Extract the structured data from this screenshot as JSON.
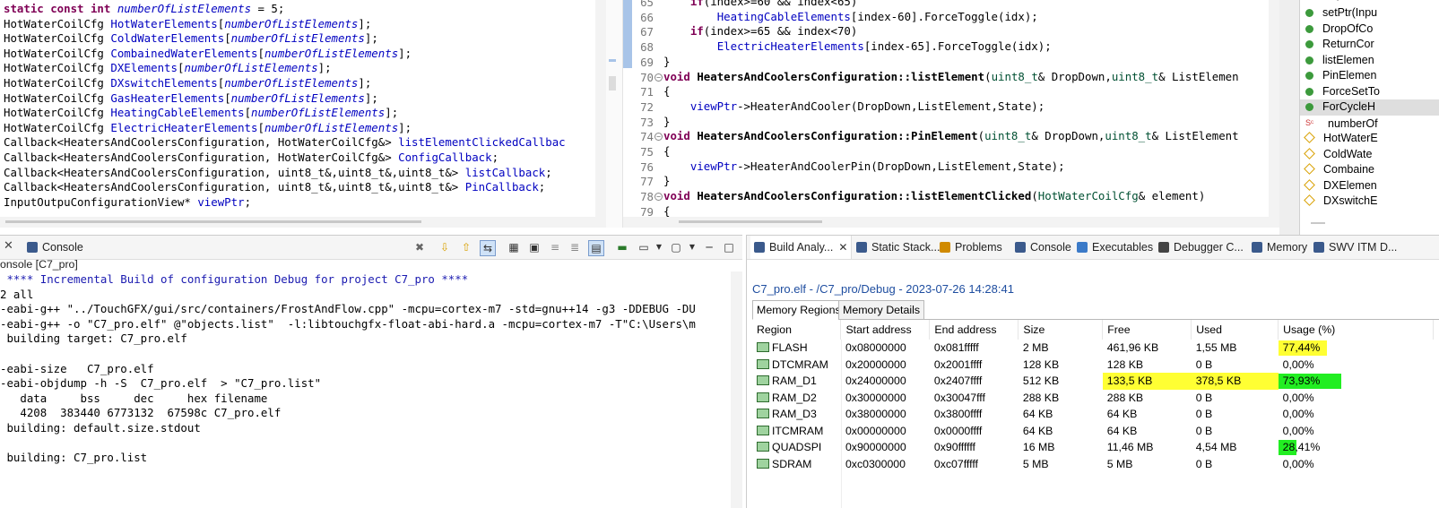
{
  "header_code": {
    "lines": [
      [
        [
          "kw",
          "static const int "
        ],
        [
          "it",
          "numberOfListElements"
        ],
        [
          "id",
          " = 5;"
        ]
      ],
      [
        [
          "id",
          "HotWaterCoilCfg "
        ],
        [
          "var",
          "HotWaterElements"
        ],
        [
          "id",
          "["
        ],
        [
          "it",
          "numberOfListElements"
        ],
        [
          "id",
          "];"
        ]
      ],
      [
        [
          "id",
          "HotWaterCoilCfg "
        ],
        [
          "var",
          "ColdWaterElements"
        ],
        [
          "id",
          "["
        ],
        [
          "it",
          "numberOfListElements"
        ],
        [
          "id",
          "];"
        ]
      ],
      [
        [
          "id",
          "HotWaterCoilCfg "
        ],
        [
          "var",
          "CombainedWaterElements"
        ],
        [
          "id",
          "["
        ],
        [
          "it",
          "numberOfListElements"
        ],
        [
          "id",
          "];"
        ]
      ],
      [
        [
          "id",
          "HotWaterCoilCfg "
        ],
        [
          "var",
          "DXElements"
        ],
        [
          "id",
          "["
        ],
        [
          "it",
          "numberOfListElements"
        ],
        [
          "id",
          "];"
        ]
      ],
      [
        [
          "id",
          "HotWaterCoilCfg "
        ],
        [
          "var",
          "DXswitchElements"
        ],
        [
          "id",
          "["
        ],
        [
          "it",
          "numberOfListElements"
        ],
        [
          "id",
          "];"
        ]
      ],
      [
        [
          "id",
          "HotWaterCoilCfg "
        ],
        [
          "var",
          "GasHeaterElements"
        ],
        [
          "id",
          "["
        ],
        [
          "it",
          "numberOfListElements"
        ],
        [
          "id",
          "];"
        ]
      ],
      [
        [
          "id",
          "HotWaterCoilCfg "
        ],
        [
          "var",
          "HeatingCableElements"
        ],
        [
          "id",
          "["
        ],
        [
          "it",
          "numberOfListElements"
        ],
        [
          "id",
          "];"
        ]
      ],
      [
        [
          "id",
          "HotWaterCoilCfg "
        ],
        [
          "var",
          "ElectricHeaterElements"
        ],
        [
          "id",
          "["
        ],
        [
          "it",
          "numberOfListElements"
        ],
        [
          "id",
          "];"
        ]
      ],
      [
        [
          "id",
          "Callback<HeatersAndCoolersConfiguration, HotWaterCoilCfg&> "
        ],
        [
          "var",
          "listElementClickedCallbac"
        ]
      ],
      [
        [
          "id",
          "Callback<HeatersAndCoolersConfiguration, HotWaterCoilCfg&> "
        ],
        [
          "var",
          "ConfigCallback"
        ],
        [
          "id",
          ";"
        ]
      ],
      [
        [
          "id",
          "Callback<HeatersAndCoolersConfiguration, uint8_t&,uint8_t&,uint8_t&> "
        ],
        [
          "var",
          "listCallback"
        ],
        [
          "id",
          ";"
        ]
      ],
      [
        [
          "id",
          "Callback<HeatersAndCoolersConfiguration, uint8_t&,uint8_t&,uint8_t&> "
        ],
        [
          "var",
          "PinCallback"
        ],
        [
          "id",
          ";"
        ]
      ],
      [
        [
          "id",
          "InputOutpuConfigurationView* "
        ],
        [
          "var",
          "viewPtr"
        ],
        [
          "id",
          ";"
        ]
      ]
    ]
  },
  "source_code": {
    "line_numbers": [
      "65",
      "66",
      "67",
      "68",
      "69",
      "70",
      "71",
      "72",
      "73",
      "74",
      "75",
      "76",
      "77",
      "78",
      "79"
    ],
    "fold_markers": [
      "70",
      "74",
      "78"
    ],
    "lines": [
      [
        [
          "id",
          "    "
        ],
        [
          "kw",
          "if"
        ],
        [
          "id",
          "(index>=60 && index<65)"
        ]
      ],
      [
        [
          "id",
          "        "
        ],
        [
          "var",
          "HeatingCableElements"
        ],
        [
          "id",
          "[index-60].ForceToggle(idx);"
        ]
      ],
      [
        [
          "id",
          "    "
        ],
        [
          "kw",
          "if"
        ],
        [
          "id",
          "(index>=65 && index<70)"
        ]
      ],
      [
        [
          "id",
          "        "
        ],
        [
          "var",
          "ElectricHeaterElements"
        ],
        [
          "id",
          "[index-65].ForceToggle(idx);"
        ]
      ],
      [
        [
          "id",
          "}"
        ]
      ],
      [
        [
          "kw",
          "void "
        ],
        [
          "b",
          "HeatersAndCoolersConfiguration::listElement"
        ],
        [
          "id",
          "("
        ],
        [
          "kw2",
          "uint8_t"
        ],
        [
          "id",
          "& DropDown,"
        ],
        [
          "kw2",
          "uint8_t"
        ],
        [
          "id",
          "& ListElemen"
        ]
      ],
      [
        [
          "id",
          "{"
        ]
      ],
      [
        [
          "id",
          "    "
        ],
        [
          "var",
          "viewPtr"
        ],
        [
          "id",
          "->HeaterAndCooler(DropDown,ListElement,State);"
        ]
      ],
      [
        [
          "id",
          "}"
        ]
      ],
      [
        [
          "kw",
          "void "
        ],
        [
          "b",
          "HeatersAndCoolersConfiguration::PinElement"
        ],
        [
          "id",
          "("
        ],
        [
          "kw2",
          "uint8_t"
        ],
        [
          "id",
          "& DropDown,"
        ],
        [
          "kw2",
          "uint8_t"
        ],
        [
          "id",
          "& ListElement"
        ]
      ],
      [
        [
          "id",
          "{"
        ]
      ],
      [
        [
          "id",
          "    "
        ],
        [
          "var",
          "viewPtr"
        ],
        [
          "id",
          "->HeaterAndCoolerPin(DropDown,ListElement,State);"
        ]
      ],
      [
        [
          "id",
          "}"
        ]
      ],
      [
        [
          "kw",
          "void "
        ],
        [
          "b",
          "HeatersAndCoolersConfiguration::listElementClicked"
        ],
        [
          "id",
          "("
        ],
        [
          "kw2",
          "HotWaterCoilCfg"
        ],
        [
          "id",
          "& element)"
        ]
      ],
      [
        [
          "id",
          "{"
        ]
      ]
    ]
  },
  "outline": {
    "items": [
      {
        "label": "setPtr(Inpu",
        "icon": "method-public-icon"
      },
      {
        "label": "DropOfCo",
        "icon": "method-public-icon"
      },
      {
        "label": "ReturnCor",
        "icon": "method-public-icon"
      },
      {
        "label": "listElemen",
        "icon": "method-public-icon"
      },
      {
        "label": "PinElemen",
        "icon": "method-public-icon"
      },
      {
        "label": "ForceSetTo",
        "icon": "method-public-icon"
      },
      {
        "label": "ForCycleH",
        "icon": "method-public-icon"
      },
      {
        "label": "numberOf",
        "icon": "static-const-field-icon"
      },
      {
        "label": "HotWaterE",
        "icon": "field-icon"
      },
      {
        "label": "ColdWate",
        "icon": "field-icon"
      },
      {
        "label": "Combaine",
        "icon": "field-icon"
      },
      {
        "label": "DXElemen",
        "icon": "field-icon"
      },
      {
        "label": "DXswitchE",
        "icon": "field-icon"
      }
    ]
  },
  "console": {
    "tab_label": "Console",
    "title": "onsole [C7_pro]",
    "lines": [
      " **** Incremental Build of configuration Debug for project C7_pro ****",
      "2 all",
      "-eabi-g++ \"../TouchGFX/gui/src/containers/FrostAndFlow.cpp\" -mcpu=cortex-m7 -std=gnu++14 -g3 -DDEBUG -DU",
      "-eabi-g++ -o \"C7_pro.elf\" @\"objects.list\"  -l:libtouchgfx-float-abi-hard.a -mcpu=cortex-m7 -T\"C:\\Users\\m",
      " building target: C7_pro.elf",
      "",
      "-eabi-size   C7_pro.elf",
      "-eabi-objdump -h -S  C7_pro.elf  > \"C7_pro.list\"",
      "   data     bss     dec     hex filename",
      "   4208  383440 6773132  67598c C7_pro.elf",
      " building: default.size.stdout",
      "",
      " building: C7_pro.list"
    ]
  },
  "bottom_tabs": [
    {
      "label": "Build Analy...",
      "icon": "build-analyzer-icon",
      "active": true
    },
    {
      "label": "Static Stack...",
      "icon": "static-stack-icon"
    },
    {
      "label": "Problems",
      "icon": "problems-icon"
    },
    {
      "label": "Console",
      "icon": "console-icon"
    },
    {
      "label": "Executables",
      "icon": "executables-icon"
    },
    {
      "label": "Debugger C...",
      "icon": "debugger-icon"
    },
    {
      "label": "Memory",
      "icon": "memory-icon"
    },
    {
      "label": "SWV ITM D...",
      "icon": "swv-icon"
    }
  ],
  "build_analyzer": {
    "title": "C7_pro.elf - /C7_pro/Debug - 2023-07-26 14:28:41",
    "subtabs": [
      "Memory Regions",
      "Memory Details"
    ],
    "columns": [
      "Region",
      "Start address",
      "End address",
      "Size",
      "Free",
      "Used",
      "Usage (%)"
    ],
    "rows": [
      {
        "region": "FLASH",
        "start": "0x08000000",
        "end": "0x081fffff",
        "size": "2 MB",
        "free": "461,96 KB",
        "used": "1,55 MB",
        "usage": "77,44%",
        "usage_fill": 0.7744,
        "usage_color": "#ffff33",
        "free_hl": false,
        "used_hl": false
      },
      {
        "region": "DTCMRAM",
        "start": "0x20000000",
        "end": "0x2001ffff",
        "size": "128 KB",
        "free": "128 KB",
        "used": "0 B",
        "usage": "0,00%",
        "usage_fill": 0,
        "usage_color": "",
        "free_hl": false,
        "used_hl": false
      },
      {
        "region": "RAM_D1",
        "start": "0x24000000",
        "end": "0x2407ffff",
        "size": "512 KB",
        "free": "133,5 KB",
        "used": "378,5 KB",
        "usage": "73,93%",
        "usage_fill": 1.0,
        "usage_color": "#22ee22",
        "free_hl": true,
        "used_hl": true
      },
      {
        "region": "RAM_D2",
        "start": "0x30000000",
        "end": "0x30047fff",
        "size": "288 KB",
        "free": "288 KB",
        "used": "0 B",
        "usage": "0,00%",
        "usage_fill": 0,
        "usage_color": "",
        "free_hl": false,
        "used_hl": false
      },
      {
        "region": "RAM_D3",
        "start": "0x38000000",
        "end": "0x3800ffff",
        "size": "64 KB",
        "free": "64 KB",
        "used": "0 B",
        "usage": "0,00%",
        "usage_fill": 0,
        "usage_color": "",
        "free_hl": false,
        "used_hl": false
      },
      {
        "region": "ITCMRAM",
        "start": "0x00000000",
        "end": "0x0000ffff",
        "size": "64 KB",
        "free": "64 KB",
        "used": "0 B",
        "usage": "0,00%",
        "usage_fill": 0,
        "usage_color": "",
        "free_hl": false,
        "used_hl": false
      },
      {
        "region": "QUADSPI",
        "start": "0x90000000",
        "end": "0x90ffffff",
        "size": "16 MB",
        "free": "11,46 MB",
        "used": "4,54 MB",
        "usage": "28,41%",
        "usage_fill": 0.2841,
        "usage_color": "#22ee22",
        "free_hl": false,
        "used_hl": false
      },
      {
        "region": "SDRAM",
        "start": "0xc0300000",
        "end": "0xc07fffff",
        "size": "5 MB",
        "free": "5 MB",
        "used": "0 B",
        "usage": "0,00%",
        "usage_fill": 0,
        "usage_color": "",
        "free_hl": false,
        "used_hl": false
      }
    ]
  },
  "colors": {
    "keyword": "#7f0055",
    "field": "#0000c0",
    "type": "#005032",
    "highlight_yellow": "#ffff33",
    "highlight_green": "#22ee22",
    "link_blue": "#1f4ea0"
  }
}
